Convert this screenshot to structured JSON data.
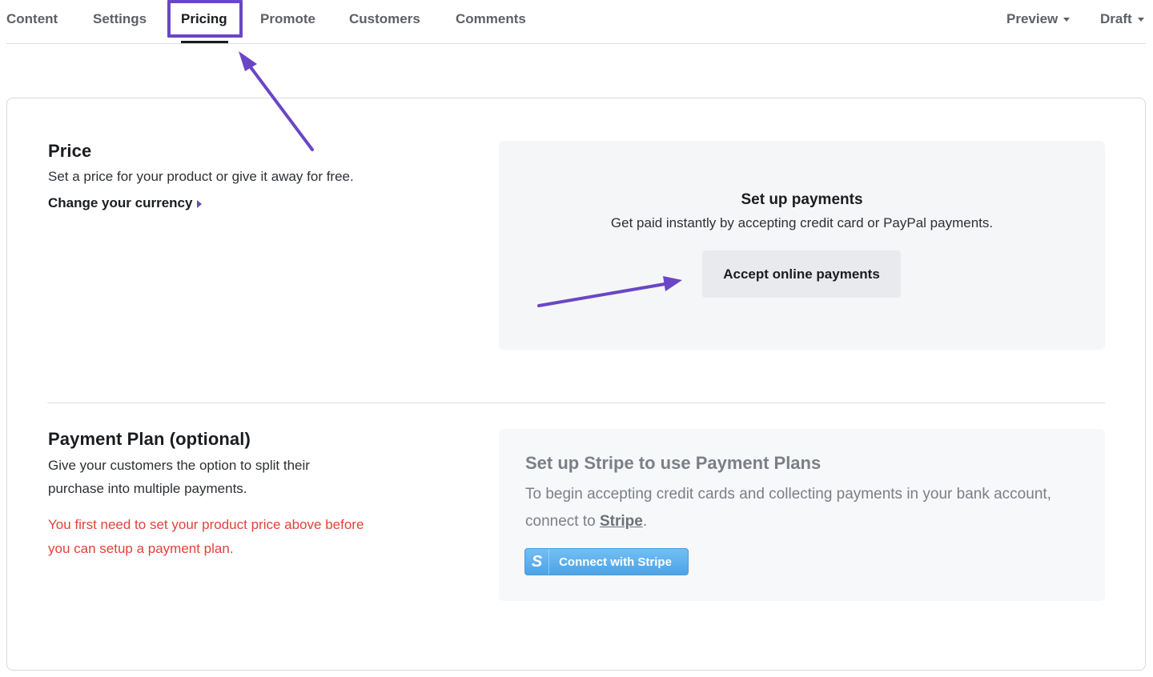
{
  "colors": {
    "accent": "#6a46c6",
    "warning": "#e5403a",
    "stripe_blue": "#4ea3e4"
  },
  "nav": {
    "tabs": [
      {
        "label": "Content"
      },
      {
        "label": "Settings"
      },
      {
        "label": "Pricing",
        "active": true
      },
      {
        "label": "Promote"
      },
      {
        "label": "Customers"
      },
      {
        "label": "Comments"
      }
    ],
    "preview_label": "Preview",
    "status_label": "Draft"
  },
  "price": {
    "title": "Price",
    "description": "Set a price for your product or give it away for free.",
    "change_currency_label": "Change your currency"
  },
  "payments": {
    "title": "Set up payments",
    "description": "Get paid instantly by accepting credit card or PayPal payments.",
    "button_label": "Accept online payments"
  },
  "payment_plan": {
    "title": "Payment Plan (optional)",
    "description": "Give your customers the option to split their purchase into multiple payments.",
    "warning": "You first need to set your product price above before you can setup a payment plan."
  },
  "stripe": {
    "title": "Set up Stripe to use Payment Plans",
    "description_prefix": "To begin accepting credit cards and collecting payments in your bank account, connect to ",
    "link_label": "Stripe",
    "description_suffix": ".",
    "badge": "S",
    "button_label": "Connect with Stripe"
  },
  "icons": [
    "caret-right-icon",
    "dropdown-caret-icon",
    "stripe-s-icon",
    "annotation-arrow-icon"
  ]
}
